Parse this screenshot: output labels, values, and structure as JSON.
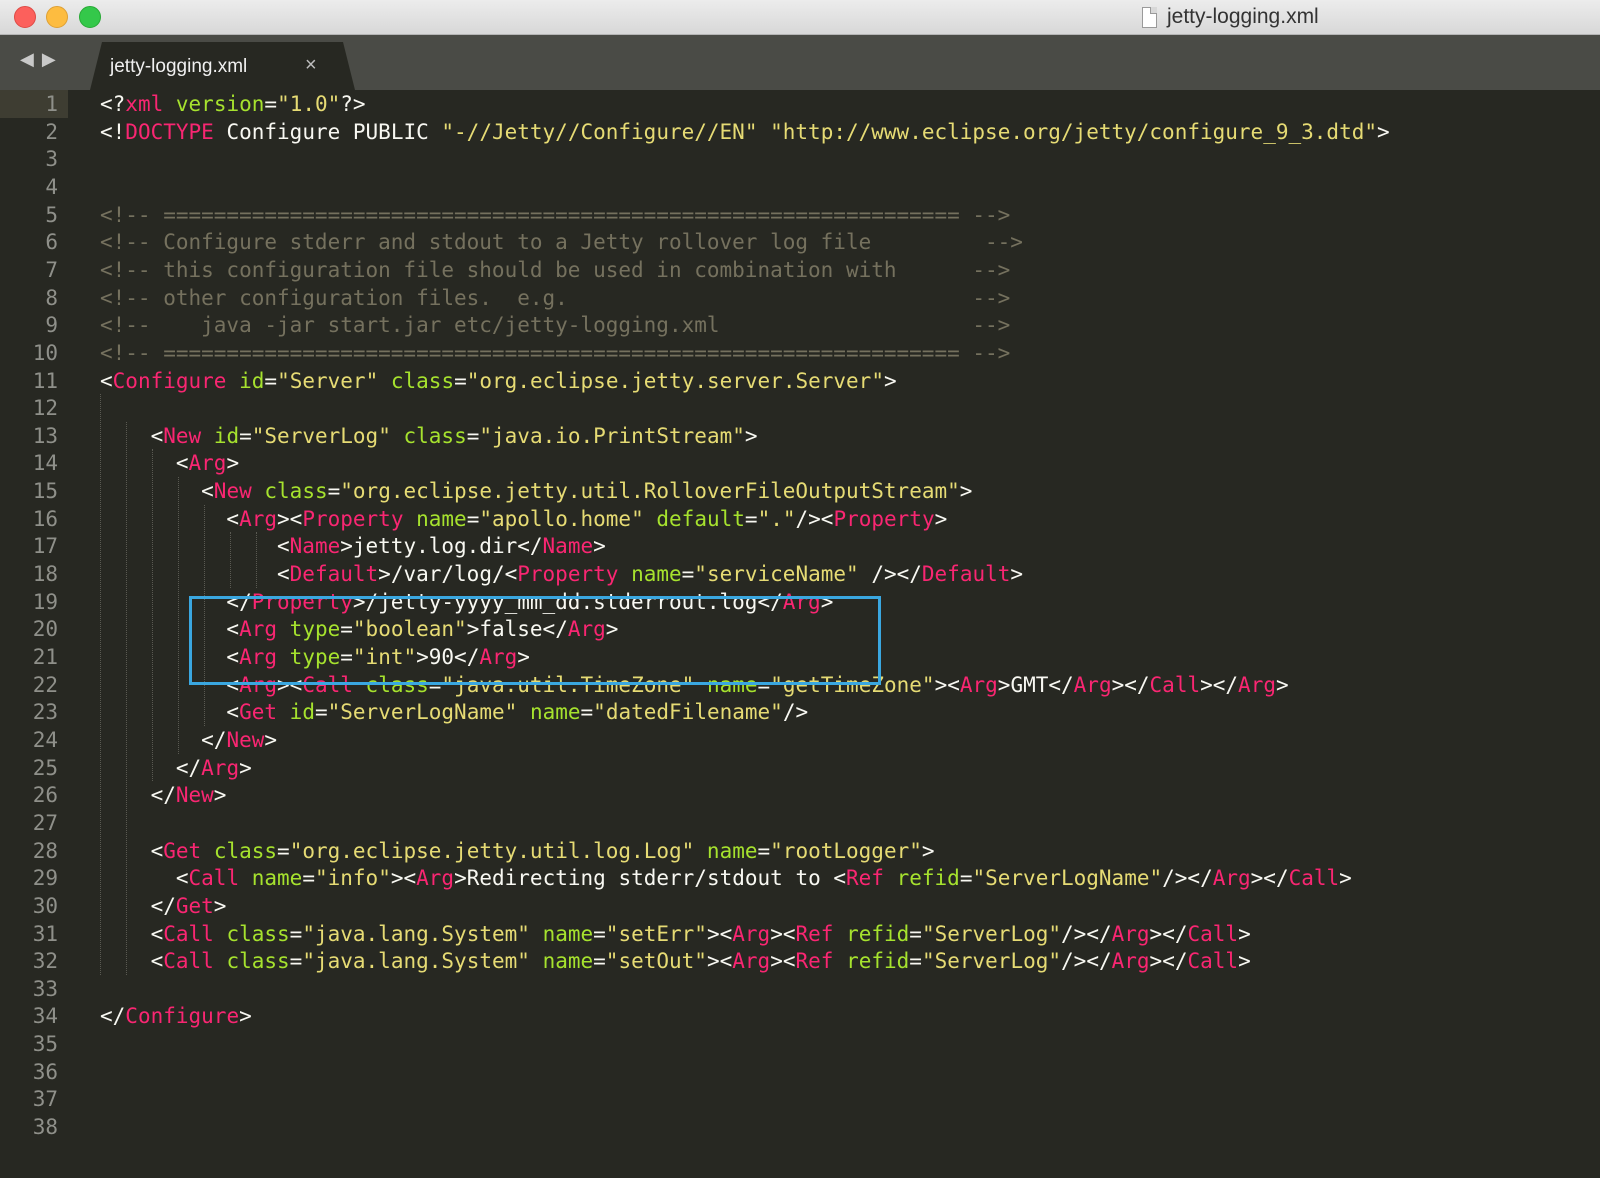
{
  "window": {
    "title": "jetty-logging.xml"
  },
  "tabs": [
    {
      "label": "jetty-logging.xml",
      "close_glyph": "×"
    }
  ],
  "nav": {
    "back_glyph": "◀",
    "forward_glyph": "▶"
  },
  "editor": {
    "current_line": 1,
    "line_count": 38,
    "highlight": {
      "from_line": 19,
      "to_line": 21,
      "color": "#3aa7e0"
    },
    "colors": {
      "background": "#272822",
      "text": "#f8f8f2",
      "tag": "#f92672",
      "attribute": "#a6e22e",
      "string": "#e6db74",
      "comment": "#75715e",
      "line_number": "#8f908a"
    },
    "lines": [
      [
        [
          "d",
          "<?"
        ],
        [
          "t",
          "xml"
        ],
        [
          "d",
          " "
        ],
        [
          "a",
          "version"
        ],
        [
          "d",
          "="
        ],
        [
          "s",
          "\"1.0\""
        ],
        [
          "d",
          "?>"
        ]
      ],
      [
        [
          "d",
          "<!"
        ],
        [
          "t",
          "DOCTYPE"
        ],
        [
          "d",
          " Configure PUBLIC "
        ],
        [
          "s",
          "\"-//Jetty//Configure//EN\""
        ],
        [
          "d",
          " "
        ],
        [
          "s",
          "\"http://www.eclipse.org/jetty/configure_9_3.dtd\""
        ],
        [
          "d",
          ">"
        ]
      ],
      [],
      [],
      [
        [
          "c",
          "<!-- =============================================================== -->"
        ]
      ],
      [
        [
          "c",
          "<!-- Configure stderr and stdout to a Jetty rollover log file         -->"
        ]
      ],
      [
        [
          "c",
          "<!-- this configuration file should be used in combination with      -->"
        ]
      ],
      [
        [
          "c",
          "<!-- other configuration files.  e.g.                                -->"
        ]
      ],
      [
        [
          "c",
          "<!--    java -jar start.jar etc/jetty-logging.xml                    -->"
        ]
      ],
      [
        [
          "c",
          "<!-- =============================================================== -->"
        ]
      ],
      [
        [
          "d",
          "<"
        ],
        [
          "t",
          "Configure"
        ],
        [
          "d",
          " "
        ],
        [
          "a",
          "id"
        ],
        [
          "d",
          "="
        ],
        [
          "s",
          "\"Server\""
        ],
        [
          "d",
          " "
        ],
        [
          "a",
          "class"
        ],
        [
          "d",
          "="
        ],
        [
          "s",
          "\"org.eclipse.jetty.server.Server\""
        ],
        [
          "d",
          ">"
        ]
      ],
      [],
      [
        [
          "d",
          "    <"
        ],
        [
          "t",
          "New"
        ],
        [
          "d",
          " "
        ],
        [
          "a",
          "id"
        ],
        [
          "d",
          "="
        ],
        [
          "s",
          "\"ServerLog\""
        ],
        [
          "d",
          " "
        ],
        [
          "a",
          "class"
        ],
        [
          "d",
          "="
        ],
        [
          "s",
          "\"java.io.PrintStream\""
        ],
        [
          "d",
          ">"
        ]
      ],
      [
        [
          "d",
          "      <"
        ],
        [
          "t",
          "Arg"
        ],
        [
          "d",
          ">"
        ]
      ],
      [
        [
          "d",
          "        <"
        ],
        [
          "t",
          "New"
        ],
        [
          "d",
          " "
        ],
        [
          "a",
          "class"
        ],
        [
          "d",
          "="
        ],
        [
          "s",
          "\"org.eclipse.jetty.util.RolloverFileOutputStream\""
        ],
        [
          "d",
          ">"
        ]
      ],
      [
        [
          "d",
          "          <"
        ],
        [
          "t",
          "Arg"
        ],
        [
          "d",
          "><"
        ],
        [
          "t",
          "Property"
        ],
        [
          "d",
          " "
        ],
        [
          "a",
          "name"
        ],
        [
          "d",
          "="
        ],
        [
          "s",
          "\"apollo.home\""
        ],
        [
          "d",
          " "
        ],
        [
          "a",
          "default"
        ],
        [
          "d",
          "="
        ],
        [
          "s",
          "\".\""
        ],
        [
          "d",
          "/><"
        ],
        [
          "t",
          "Property"
        ],
        [
          "d",
          ">"
        ]
      ],
      [
        [
          "d",
          "              <"
        ],
        [
          "t",
          "Name"
        ],
        [
          "d",
          ">jetty.log.dir</"
        ],
        [
          "t",
          "Name"
        ],
        [
          "d",
          ">"
        ]
      ],
      [
        [
          "d",
          "              <"
        ],
        [
          "t",
          "Default"
        ],
        [
          "d",
          ">/var/log/<"
        ],
        [
          "t",
          "Property"
        ],
        [
          "d",
          " "
        ],
        [
          "a",
          "name"
        ],
        [
          "d",
          "="
        ],
        [
          "s",
          "\"serviceName\""
        ],
        [
          "d",
          " /></"
        ],
        [
          "t",
          "Default"
        ],
        [
          "d",
          ">"
        ]
      ],
      [
        [
          "d",
          "          </"
        ],
        [
          "t",
          "Property"
        ],
        [
          "d",
          ">/jetty-yyyy_mm_dd.stderrout.log</"
        ],
        [
          "t",
          "Arg"
        ],
        [
          "d",
          ">"
        ]
      ],
      [
        [
          "d",
          "          <"
        ],
        [
          "t",
          "Arg"
        ],
        [
          "d",
          " "
        ],
        [
          "a",
          "type"
        ],
        [
          "d",
          "="
        ],
        [
          "s",
          "\"boolean\""
        ],
        [
          "d",
          ">false</"
        ],
        [
          "t",
          "Arg"
        ],
        [
          "d",
          ">"
        ]
      ],
      [
        [
          "d",
          "          <"
        ],
        [
          "t",
          "Arg"
        ],
        [
          "d",
          " "
        ],
        [
          "a",
          "type"
        ],
        [
          "d",
          "="
        ],
        [
          "s",
          "\"int\""
        ],
        [
          "d",
          ">90</"
        ],
        [
          "t",
          "Arg"
        ],
        [
          "d",
          ">"
        ]
      ],
      [
        [
          "d",
          "          <"
        ],
        [
          "t",
          "Arg"
        ],
        [
          "d",
          "><"
        ],
        [
          "t",
          "Call"
        ],
        [
          "d",
          " "
        ],
        [
          "a",
          "class"
        ],
        [
          "d",
          "="
        ],
        [
          "s",
          "\"java.util.TimeZone\""
        ],
        [
          "d",
          " "
        ],
        [
          "a",
          "name"
        ],
        [
          "d",
          "="
        ],
        [
          "s",
          "\"getTimeZone\""
        ],
        [
          "d",
          "><"
        ],
        [
          "t",
          "Arg"
        ],
        [
          "d",
          ">GMT</"
        ],
        [
          "t",
          "Arg"
        ],
        [
          "d",
          "></"
        ],
        [
          "t",
          "Call"
        ],
        [
          "d",
          "></"
        ],
        [
          "t",
          "Arg"
        ],
        [
          "d",
          ">"
        ]
      ],
      [
        [
          "d",
          "          <"
        ],
        [
          "t",
          "Get"
        ],
        [
          "d",
          " "
        ],
        [
          "a",
          "id"
        ],
        [
          "d",
          "="
        ],
        [
          "s",
          "\"ServerLogName\""
        ],
        [
          "d",
          " "
        ],
        [
          "a",
          "name"
        ],
        [
          "d",
          "="
        ],
        [
          "s",
          "\"datedFilename\""
        ],
        [
          "d",
          "/>"
        ]
      ],
      [
        [
          "d",
          "        </"
        ],
        [
          "t",
          "New"
        ],
        [
          "d",
          ">"
        ]
      ],
      [
        [
          "d",
          "      </"
        ],
        [
          "t",
          "Arg"
        ],
        [
          "d",
          ">"
        ]
      ],
      [
        [
          "d",
          "    </"
        ],
        [
          "t",
          "New"
        ],
        [
          "d",
          ">"
        ]
      ],
      [],
      [
        [
          "d",
          "    <"
        ],
        [
          "t",
          "Get"
        ],
        [
          "d",
          " "
        ],
        [
          "a",
          "class"
        ],
        [
          "d",
          "="
        ],
        [
          "s",
          "\"org.eclipse.jetty.util.log.Log\""
        ],
        [
          "d",
          " "
        ],
        [
          "a",
          "name"
        ],
        [
          "d",
          "="
        ],
        [
          "s",
          "\"rootLogger\""
        ],
        [
          "d",
          ">"
        ]
      ],
      [
        [
          "d",
          "      <"
        ],
        [
          "t",
          "Call"
        ],
        [
          "d",
          " "
        ],
        [
          "a",
          "name"
        ],
        [
          "d",
          "="
        ],
        [
          "s",
          "\"info\""
        ],
        [
          "d",
          "><"
        ],
        [
          "t",
          "Arg"
        ],
        [
          "d",
          ">Redirecting stderr/stdout to <"
        ],
        [
          "t",
          "Ref"
        ],
        [
          "d",
          " "
        ],
        [
          "a",
          "refid"
        ],
        [
          "d",
          "="
        ],
        [
          "s",
          "\"ServerLogName\""
        ],
        [
          "d",
          "/></"
        ],
        [
          "t",
          "Arg"
        ],
        [
          "d",
          "></"
        ],
        [
          "t",
          "Call"
        ],
        [
          "d",
          ">"
        ]
      ],
      [
        [
          "d",
          "    </"
        ],
        [
          "t",
          "Get"
        ],
        [
          "d",
          ">"
        ]
      ],
      [
        [
          "d",
          "    <"
        ],
        [
          "t",
          "Call"
        ],
        [
          "d",
          " "
        ],
        [
          "a",
          "class"
        ],
        [
          "d",
          "="
        ],
        [
          "s",
          "\"java.lang.System\""
        ],
        [
          "d",
          " "
        ],
        [
          "a",
          "name"
        ],
        [
          "d",
          "="
        ],
        [
          "s",
          "\"setErr\""
        ],
        [
          "d",
          "><"
        ],
        [
          "t",
          "Arg"
        ],
        [
          "d",
          "><"
        ],
        [
          "t",
          "Ref"
        ],
        [
          "d",
          " "
        ],
        [
          "a",
          "refid"
        ],
        [
          "d",
          "="
        ],
        [
          "s",
          "\"ServerLog\""
        ],
        [
          "d",
          "/></"
        ],
        [
          "t",
          "Arg"
        ],
        [
          "d",
          "></"
        ],
        [
          "t",
          "Call"
        ],
        [
          "d",
          ">"
        ]
      ],
      [
        [
          "d",
          "    <"
        ],
        [
          "t",
          "Call"
        ],
        [
          "d",
          " "
        ],
        [
          "a",
          "class"
        ],
        [
          "d",
          "="
        ],
        [
          "s",
          "\"java.lang.System\""
        ],
        [
          "d",
          " "
        ],
        [
          "a",
          "name"
        ],
        [
          "d",
          "="
        ],
        [
          "s",
          "\"setOut\""
        ],
        [
          "d",
          "><"
        ],
        [
          "t",
          "Arg"
        ],
        [
          "d",
          "><"
        ],
        [
          "t",
          "Ref"
        ],
        [
          "d",
          " "
        ],
        [
          "a",
          "refid"
        ],
        [
          "d",
          "="
        ],
        [
          "s",
          "\"ServerLog\""
        ],
        [
          "d",
          "/></"
        ],
        [
          "t",
          "Arg"
        ],
        [
          "d",
          "></"
        ],
        [
          "t",
          "Call"
        ],
        [
          "d",
          ">"
        ]
      ],
      [],
      [
        [
          "d",
          "</"
        ],
        [
          "t",
          "Configure"
        ],
        [
          "d",
          ">"
        ]
      ],
      [],
      [],
      [],
      []
    ]
  }
}
